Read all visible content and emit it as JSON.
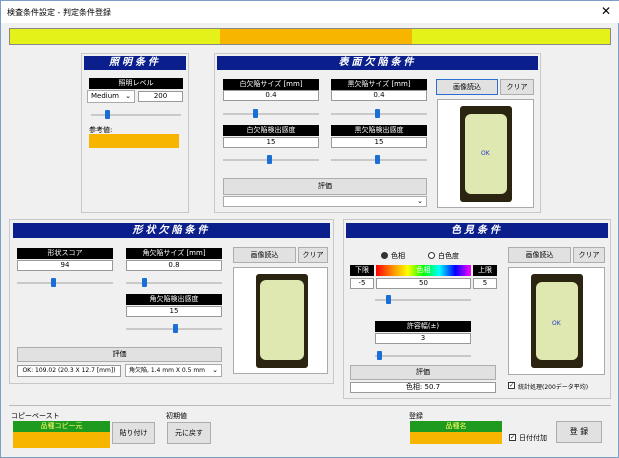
{
  "window": {
    "title": "検査条件設定 - 判定条件登録",
    "close": "✕"
  },
  "lighting": {
    "header": "照明条件",
    "level_label": "照明レベル",
    "mode": "Medium",
    "level_value": "200",
    "ref_label": "参考値:"
  },
  "surface": {
    "header": "表面欠陥条件",
    "white_size_label": "白欠陥サイズ [mm]",
    "white_size_value": "0.4",
    "black_size_label": "黒欠陥サイズ [mm]",
    "black_size_value": "0.4",
    "white_sens_label": "白欠陥検出感度",
    "white_sens_value": "15",
    "black_sens_label": "黒欠陥検出感度",
    "black_sens_value": "15",
    "eval_button": "評価",
    "load_button": "画像読込",
    "clear_button": "クリア",
    "ok_text": "OK"
  },
  "shape": {
    "header": "形状欠陥条件",
    "score_label": "形状スコア",
    "score_value": "94",
    "corner_size_label": "角欠陥サイズ [mm]",
    "corner_size_value": "0.8",
    "corner_sens_label": "角欠陥検出感度",
    "corner_sens_value": "15",
    "eval_button": "評価",
    "result_text": "OK: 109.02 (20.3 X 12.7 [mm])",
    "corner_result": "角欠陥, 1.4 mm X 0.5 mm",
    "load_button": "画像読込",
    "clear_button": "クリア"
  },
  "color": {
    "header": "色見条件",
    "radio_hue": "色相",
    "radio_white": "白色度",
    "lower_label": "下限",
    "hue_label": "色相",
    "upper_label": "上限",
    "lower_value": "-5",
    "hue_value": "50",
    "upper_value": "5",
    "tolerance_label": "許容幅(±)",
    "tolerance_value": "3",
    "eval_button": "評価",
    "result_text": "色相: 50.7",
    "load_button": "画像読込",
    "clear_button": "クリア",
    "ok_text": "OK",
    "stats_label": "統計処理(200データ平均)"
  },
  "copypaste": {
    "group_label": "コピーペースト",
    "source_label": "品種コピー元",
    "paste_button": "貼り付け"
  },
  "init": {
    "group_label": "初期値",
    "reset_button": "元に戻す"
  },
  "register": {
    "group_label": "登録",
    "name_label": "品種名",
    "date_label": "日付付加",
    "register_button": "登 録"
  }
}
